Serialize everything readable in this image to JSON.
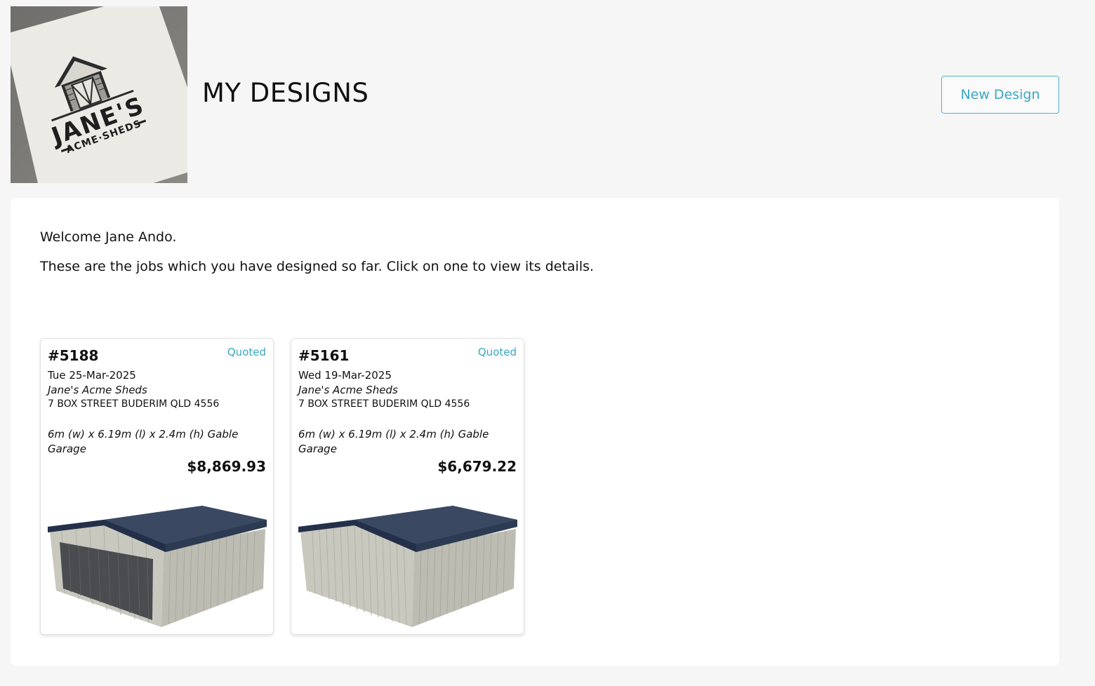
{
  "header": {
    "logo": {
      "brand_line1": "JANE'S",
      "brand_line2": "ACME·SHEDS"
    },
    "title": "MY DESIGNS",
    "new_design_label": "New Design"
  },
  "main": {
    "welcome_text": "Welcome Jane Ando.",
    "intro_text": "These are the jobs which you have designed so far. Click on one to view its details.",
    "jobs": [
      {
        "number": "#5188",
        "status": "Quoted",
        "date": "Tue 25-Mar-2025",
        "company": "Jane's Acme Sheds",
        "address": "7 BOX STREET BUDERIM QLD 4556",
        "description": "6m (w) x 6.19m (l) x 2.4m (h) Gable Garage",
        "price": "$8,869.93",
        "image": "shed-with-roller-door"
      },
      {
        "number": "#5161",
        "status": "Quoted",
        "date": "Wed 19-Mar-2025",
        "company": "Jane's Acme Sheds",
        "address": "7 BOX STREET BUDERIM QLD 4556",
        "description": "6m (w) x 6.19m (l) x 2.4m (h) Gable Garage",
        "price": "$6,679.22",
        "image": "shed-plain"
      }
    ]
  },
  "colors": {
    "accent": "#3aa7c0",
    "page_background": "#f6f6f6",
    "roof": "#2c3a52",
    "wall": "#c9c8bf"
  }
}
